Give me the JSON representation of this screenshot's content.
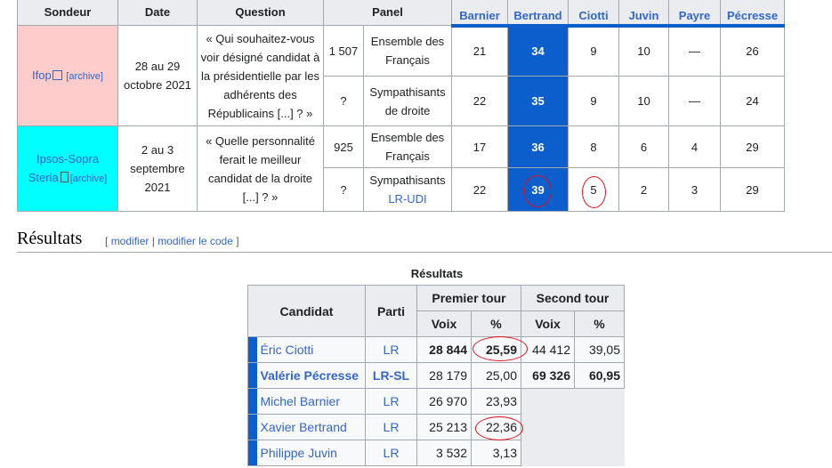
{
  "poll_table": {
    "headers": {
      "sondeur": "Sondeur",
      "date": "Date",
      "question": "Question",
      "panel": "Panel",
      "candidates": [
        "Barnier",
        "Bertrand",
        "Ciotti",
        "Juvin",
        "Payre",
        "Pécresse"
      ]
    },
    "rows": [
      {
        "sondeur": "Ifop",
        "archive": "[archive]",
        "date": "28 au 29 octobre 2021",
        "question": "« Qui souhaitez-vous voir désigné candidat à la présidentielle par les adhérents des Républicains [...] ? »",
        "sub": [
          {
            "sample": "1 507",
            "panel": "Ensemble des Français",
            "values": [
              "21",
              "34",
              "9",
              "10",
              "—",
              "26"
            ]
          },
          {
            "sample": "?",
            "panel": "Sympathisants de droite",
            "values": [
              "22",
              "35",
              "9",
              "10",
              "—",
              "24"
            ]
          }
        ]
      },
      {
        "sondeur": "Ipsos-Sopra Steria",
        "archive": "[archive]",
        "date": "2 au 3 septembre 2021",
        "question": "« Quelle personnalité ferait le meilleur candidat de la droite [...] ? »",
        "sub": [
          {
            "sample": "925",
            "panel": "Ensemble des Français",
            "values": [
              "17",
              "36",
              "8",
              "6",
              "4",
              "29"
            ]
          },
          {
            "sample": "?",
            "panel_text": "Sympathisants",
            "panel_link": "LR-UDI",
            "values": [
              "22",
              "39",
              "5",
              "2",
              "3",
              "29"
            ]
          }
        ]
      }
    ]
  },
  "results_section": {
    "title": "Résultats",
    "edit_open": "[",
    "edit": "modifier",
    "separator": "|",
    "edit_code": "modifier le code",
    "edit_close": "]"
  },
  "results_table": {
    "caption": "Résultats",
    "headers": {
      "candidat": "Candidat",
      "parti": "Parti",
      "premier_tour": "Premier tour",
      "second_tour": "Second tour",
      "voix": "Voix",
      "pct": "%"
    },
    "rows": [
      {
        "name": "Éric Ciotti",
        "party": "LR",
        "v1": "28 844",
        "p1": "25,59",
        "v2": "44 412",
        "p2": "39,05"
      },
      {
        "name": "Valérie Pécresse",
        "party": "LR-SL",
        "v1": "28 179",
        "p1": "25,00",
        "v2": "69 326",
        "p2": "60,95"
      },
      {
        "name": "Michel Barnier",
        "party": "LR",
        "v1": "26 970",
        "p1": "23,93"
      },
      {
        "name": "Xavier Bertrand",
        "party": "LR",
        "v1": "25 213",
        "p1": "22,36"
      },
      {
        "name": "Philippe Juvin",
        "party": "LR",
        "v1": "3 532",
        "p1": "3,13"
      }
    ]
  },
  "colors": {
    "winner_blue": "#0b5ecb",
    "ifop_bg": "#ffcccc",
    "ipsos_bg": "#00ffff",
    "annotation_red": "#e0101a"
  }
}
